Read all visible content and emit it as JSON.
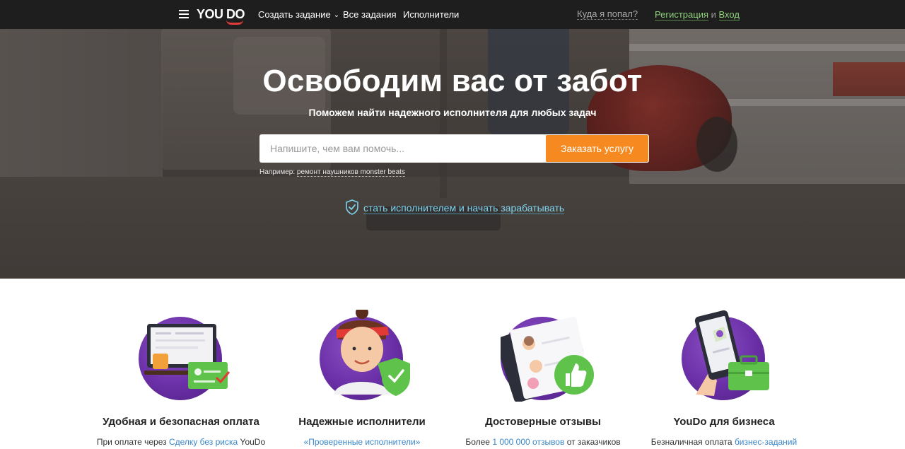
{
  "topbar": {
    "logo": "YOU DO",
    "nav": [
      {
        "label": "Создать задание"
      },
      {
        "label": "Все задания"
      },
      {
        "label": "Исполнители"
      }
    ],
    "where_link": "Куда я попал?",
    "register": "Регистрация",
    "and": "и",
    "login": "Вход"
  },
  "hero": {
    "title": "Освободим вас от забот",
    "subtitle": "Поможем найти надежного исполнителя для любых задач",
    "search_placeholder": "Напишите, чем вам помочь...",
    "order_button": "Заказать услугу",
    "example_prefix": "Например:",
    "example_link": "ремонт наушников monster beats",
    "become_link": "стать исполнителем и начать зарабатывать"
  },
  "features": [
    {
      "title": "Удобная и безопасная оплата",
      "desc_prefix": "При оплате через ",
      "desc_link": "Сделку без риска",
      "desc_suffix": " YouDo"
    },
    {
      "title": "Надежные исполнители",
      "desc_prefix": "",
      "desc_link": "«Проверенные исполнители»",
      "desc_suffix": ""
    },
    {
      "title": "Достоверные отзывы",
      "desc_prefix": "Более ",
      "desc_link": "1 000 000 отзывов",
      "desc_suffix": " от заказчиков"
    },
    {
      "title": "YouDo для бизнеса",
      "desc_prefix": "Безналичная оплата ",
      "desc_link": "бизнес-заданий",
      "desc_suffix": ""
    }
  ],
  "colors": {
    "accent_orange": "#f6891f",
    "logo_red": "#e23b35",
    "link_green": "#8fd27a",
    "link_blue": "#3a86c8",
    "purple": "#6a2fa6",
    "topbar": "#1e1e1e"
  },
  "icons": {
    "menu": "menu-icon",
    "shield": "shield-check-icon"
  }
}
